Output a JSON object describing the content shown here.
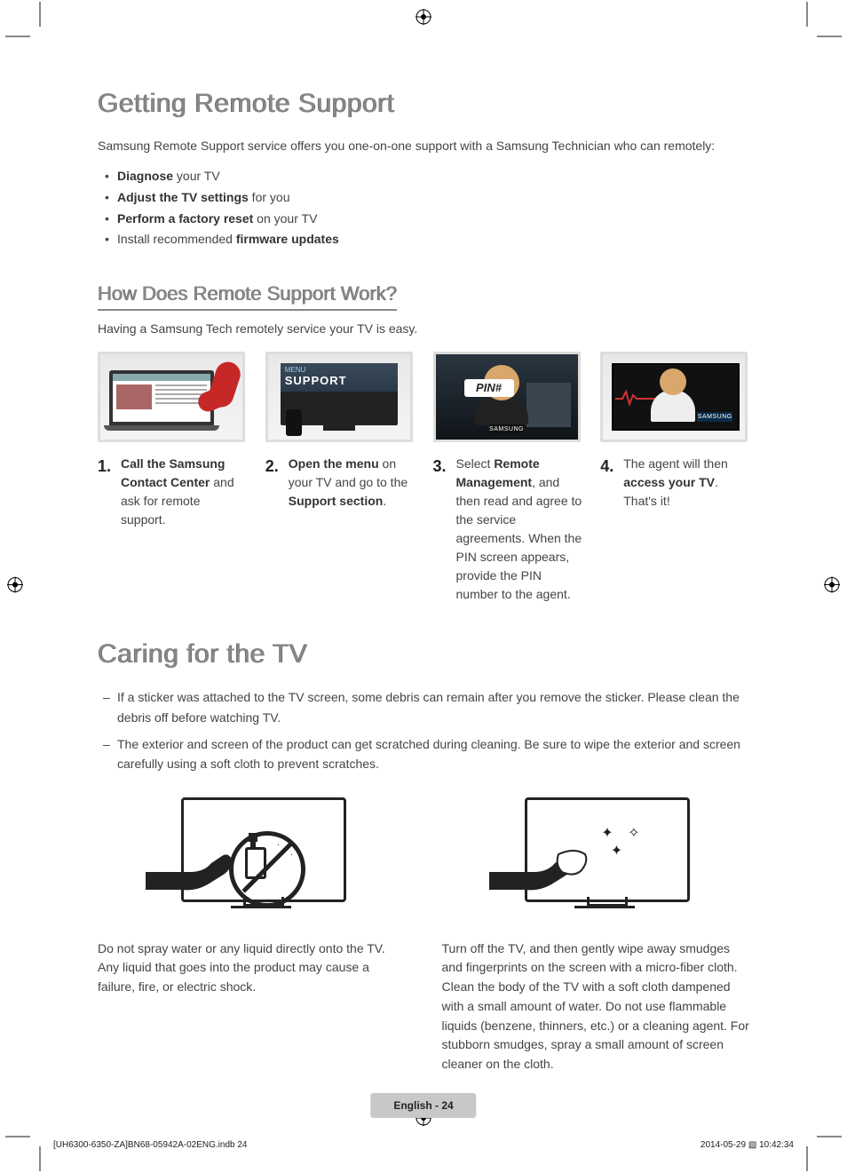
{
  "heading1": "Getting Remote Support",
  "intro": "Samsung Remote Support service offers you one-on-one support with a Samsung Technician who can remotely:",
  "bullets": [
    {
      "b": "Diagnose",
      "rest": " your TV"
    },
    {
      "b": "Adjust the TV settings",
      "rest": " for you"
    },
    {
      "b": "Perform a factory reset",
      "rest": " on your TV"
    },
    {
      "pre": "Install recommended ",
      "b": "firmware updates",
      "rest": ""
    }
  ],
  "heading2": "How Does Remote Support Work?",
  "subintro": "Having a Samsung Tech remotely service your TV is easy.",
  "steps": [
    {
      "num": "1.",
      "html": "<span class='bold'>Call the Samsung Contact Center</span> and ask for remote support."
    },
    {
      "num": "2.",
      "html": "<span class='bold'>Open the menu</span> on your TV and go to the <span class='bold'>Support section</span>."
    },
    {
      "num": "3.",
      "html": "Select <span class='bold'>Remote Management</span>, and then read and agree to the service agreements. When the PIN screen appears, provide the PIN number to the agent."
    },
    {
      "num": "4.",
      "html": "The agent will then <span class='bold'>access your TV</span>. That's it!"
    }
  ],
  "menu_label": "MENU",
  "support_label": "SUPPORT",
  "pin_label": "PIN#",
  "brand_label": "SAMSUNG",
  "heading3": "Caring for the TV",
  "dashes": [
    "If a sticker was attached to the TV screen, some debris can remain after you remove the sticker. Please clean the debris off before watching TV.",
    "The exterior and screen of the product can get scratched during cleaning. Be sure to wipe the exterior and screen carefully using a soft cloth to prevent scratches."
  ],
  "care": [
    "Do not spray water or any liquid directly onto the TV. Any liquid that goes into the product may cause a failure, fire, or electric shock.",
    "Turn off the TV, and then gently wipe away smudges and fingerprints on the screen with a micro-fiber cloth. Clean the body of the TV with a soft cloth dampened with a small amount of water. Do not use flammable liquids (benzene, thinners, etc.) or a cleaning agent. For stubborn smudges, spray a small amount of screen cleaner on the cloth."
  ],
  "footer": "English - 24",
  "print_left": "[UH6300-6350-ZA]BN68-05942A-02ENG.indb   24",
  "print_right": "2014-05-29   ▧ 10:42:34"
}
